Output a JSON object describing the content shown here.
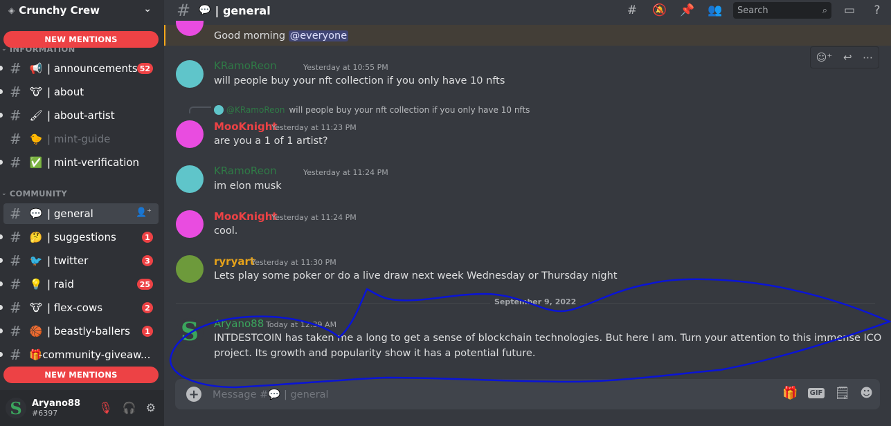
{
  "server": {
    "name": "Crunchy Crew"
  },
  "mentions_label": "NEW MENTIONS",
  "categories": {
    "info": "INFORMATION",
    "community": "COMMUNITY"
  },
  "channels": [
    {
      "emoji": "📢",
      "name": "| announcements",
      "badge": "52"
    },
    {
      "emoji": "🐮",
      "name": "| about",
      "badge": ""
    },
    {
      "emoji": "🖌",
      "name": "| about-artist",
      "badge": ""
    },
    {
      "emoji": "🐤",
      "name": "| mint-guide",
      "badge": ""
    },
    {
      "emoji": "✅",
      "name": "| mint-verification",
      "badge": ""
    },
    {
      "emoji": "💬",
      "name": "| general",
      "badge": ""
    },
    {
      "emoji": "🤔",
      "name": "| suggestions",
      "badge": "1"
    },
    {
      "emoji": "🐦",
      "name": "| twitter",
      "badge": "3"
    },
    {
      "emoji": "💡",
      "name": "| raid",
      "badge": "25"
    },
    {
      "emoji": "🐮",
      "name": "| flex-cows",
      "badge": "2"
    },
    {
      "emoji": "🏀",
      "name": "| beastly-ballers",
      "badge": "1"
    },
    {
      "emoji": "🎁",
      "name": "-community-giveaw...",
      "badge": ""
    }
  ],
  "user": {
    "name": "Aryano88",
    "tag": "#6397"
  },
  "header": {
    "channel": "| general",
    "search_placeholder": "Search"
  },
  "messages": [
    {
      "text_before": "Good morning ",
      "mention": "@everyone"
    },
    {
      "author": "KRamoReon",
      "time": "Yesterday at 10:55 PM",
      "text": "will people buy your nft collection if you only have 10 nfts"
    },
    {
      "reply_author": "@KRamoReon",
      "reply_text": "will people buy your nft collection if you only have 10 nfts",
      "author": "MooKnight",
      "time": "Yesterday at 11:23 PM",
      "text": "are you a 1 of 1 artist?"
    },
    {
      "author": "KRamoReon",
      "time": "Yesterday at 11:24 PM",
      "text": "im elon musk"
    },
    {
      "author": "MooKnight",
      "time": "Yesterday at 11:24 PM",
      "text": "cool."
    },
    {
      "author": "ryryart",
      "time": "Yesterday at 11:30 PM",
      "text": "Lets play some poker or do a live draw next week Wednesday or Thursday night"
    },
    {
      "author": "Aryano88",
      "time": "Today at 12:39 AM",
      "text_line1": "INTDESTCOIN has taken me a long to get a sense of blockchain technologies. But here I am. Turn your attention to this immense ICO",
      "text_line2": "project. Its growth and popularity show it has a potential future."
    }
  ],
  "date_divider": "September 9, 2022",
  "composer": {
    "placeholder": "Message #💬 | general"
  },
  "colors": {
    "accent": "#5865f2",
    "mention_red": "#ed4245",
    "annotation_blue": "#0a14d6",
    "kramo": "#2f7a46",
    "mooknight": "#ed4245",
    "ryryart": "#e6a21a",
    "aryano": "#3ba55d"
  },
  "icons": [
    "threads-icon",
    "mute-icon",
    "pin-icon",
    "members-icon",
    "search-icon",
    "inbox-icon",
    "help-icon",
    "gift-icon",
    "gif-icon",
    "sticker-icon",
    "emoji-icon",
    "mic-off-icon",
    "headphones-off-icon",
    "settings-icon"
  ]
}
